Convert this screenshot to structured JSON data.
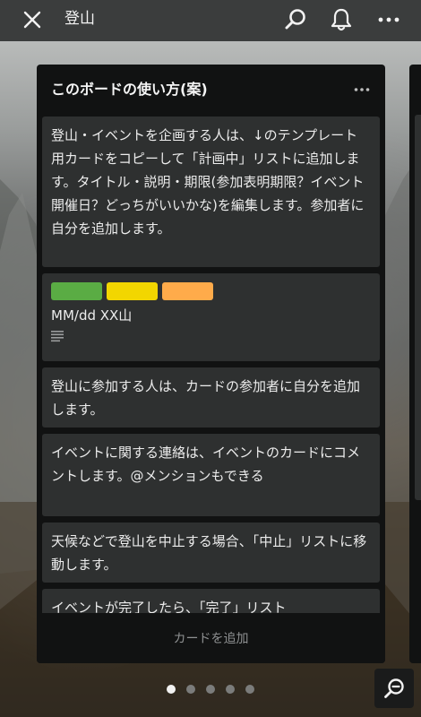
{
  "header": {
    "title": "登山",
    "close_icon": "close-icon",
    "search_icon": "search-icon",
    "bell_icon": "bell-icon",
    "more_icon": "more-horizontal-icon"
  },
  "list": {
    "title": "このボードの使い方(案)",
    "menu_icon": "more-horizontal-icon",
    "add_card_label": "カードを追加",
    "cards": [
      {
        "text": "登山・イベントを企画する人は、↓のテンプレート用カードをコピーして「計画中」リストに追加します。タイトル・説明・期限(参加表明期限？イベント開催日？どっちがいいかな)を編集します。参加者に自分を追加します。"
      },
      {
        "text": "MM/dd XX山",
        "labels": [
          "#5aac44",
          "#f2d600",
          "#ffab4a"
        ],
        "has_description": true
      },
      {
        "text": "登山に参加する人は、カードの参加者に自分を追加します。"
      },
      {
        "text": "イベントに関する連絡は、イベントのカードにコメントします。@メンションもできる"
      },
      {
        "text": "天候などで登山を中止する場合、「中止」リストに移動します。"
      },
      {
        "text": "イベントが完了したら、「完了」リスト"
      }
    ]
  },
  "pagination": {
    "count": 5,
    "active_index": 0
  },
  "zoom_icon": "zoom-out-icon",
  "colors": {
    "topbar": "#3b3d3d",
    "list_bg": "#111212",
    "card_bg": "#2e3030",
    "label_green": "#5aac44",
    "label_yellow": "#f2d600",
    "label_orange": "#ffab4a"
  }
}
